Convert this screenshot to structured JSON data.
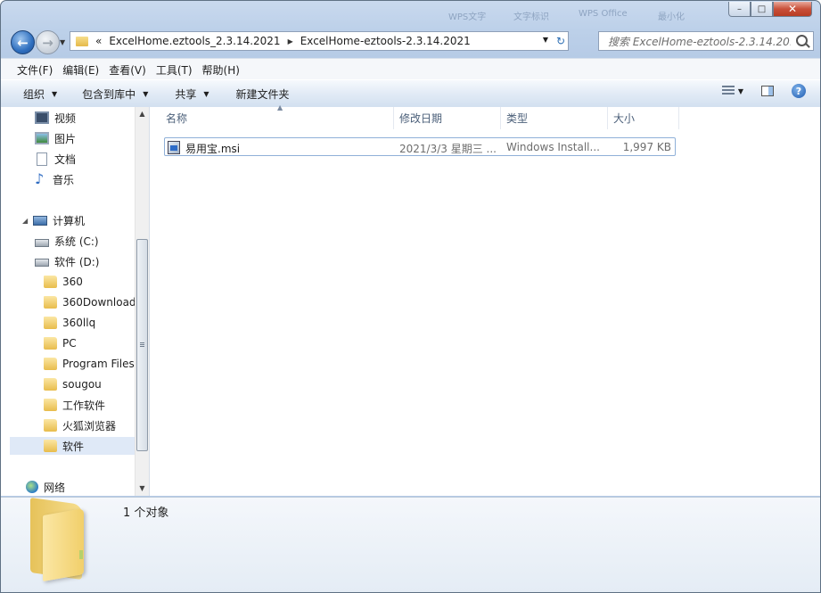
{
  "titlebar": {
    "ghost_tabs": [
      "WPS文字",
      "文字标识",
      "WPS Office",
      "最小化"
    ],
    "minimize": "–",
    "maximize": "□",
    "close": "✕"
  },
  "address": {
    "overflow": "«",
    "segments": [
      "ExcelHome.eztools_2.3.14.2021",
      "ExcelHome-eztools-2.3.14.2021"
    ]
  },
  "search": {
    "placeholder": "搜索 ExcelHome-eztools-2.3.14.20..."
  },
  "menubar": {
    "items": [
      "文件(F)",
      "编辑(E)",
      "查看(V)",
      "工具(T)",
      "帮助(H)"
    ]
  },
  "toolbar": {
    "organize": "组织",
    "include_library": "包含到库中",
    "share": "共享",
    "new_folder": "新建文件夹"
  },
  "nav": {
    "libraries": [
      "视频",
      "图片",
      "文档",
      "音乐"
    ],
    "computer": "计算机",
    "drives": [
      "系统 (C:)",
      "软件 (D:)"
    ],
    "folders": [
      "360",
      "360Download",
      "360llq",
      "PC",
      "Program Files",
      "sougou",
      "工作软件",
      "火狐浏览器",
      "软件"
    ],
    "network": "网络"
  },
  "columns": {
    "name": "名称",
    "modified": "修改日期",
    "type": "类型",
    "size": "大小"
  },
  "files": [
    {
      "name": "易用宝.msi",
      "modified": "2021/3/3 星期三 ...",
      "type": "Windows Install...",
      "size": "1,997 KB"
    }
  ],
  "details": {
    "count": "1 个对象"
  }
}
